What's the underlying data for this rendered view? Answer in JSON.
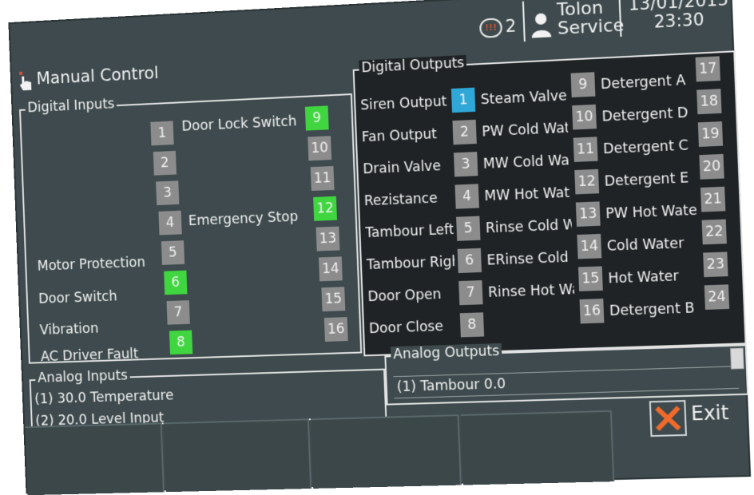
{
  "header": {
    "title": "Manual Control",
    "notification_count": "2",
    "notification_icon_text": "!!!",
    "user": {
      "line1": "Tolon",
      "line2": "Service"
    },
    "date": "13/01/2015",
    "time": "23:30"
  },
  "digital_inputs": {
    "title": "Digital Inputs",
    "labels": {
      "door_lock_switch": "Door Lock Switch",
      "emergency_stop": "Emergency Stop",
      "motor_protection": "Motor Protection",
      "door_switch": "Door Switch",
      "vibration": "Vibration",
      "ac_driver_fault": "AC Driver Fault"
    },
    "left_numbers": [
      "1",
      "2",
      "3",
      "4",
      "5",
      "6",
      "7",
      "8"
    ],
    "right_numbers": [
      "9",
      "10",
      "11",
      "12",
      "13",
      "14",
      "15",
      "16"
    ],
    "active": [
      "6",
      "8",
      "9",
      "12"
    ]
  },
  "digital_outputs": {
    "title": "Digital Outputs",
    "col1": [
      {
        "label": "Siren Output",
        "num": "1"
      },
      {
        "label": "Fan Output",
        "num": "2"
      },
      {
        "label": "Drain Valve",
        "num": "3"
      },
      {
        "label": "Rezistance",
        "num": "4"
      },
      {
        "label": "Tambour Left",
        "num": "5"
      },
      {
        "label": "Tambour Right",
        "num": "6"
      },
      {
        "label": "Door Open",
        "num": "7"
      },
      {
        "label": "Door Close",
        "num": "8"
      }
    ],
    "col2": [
      {
        "label": "Steam Valve",
        "num": "9"
      },
      {
        "label": "PW Cold Water",
        "num": "10"
      },
      {
        "label": "MW Cold Water",
        "num": "11"
      },
      {
        "label": "MW Hot Water",
        "num": "12"
      },
      {
        "label": "Rinse Cold Water",
        "num": "13"
      },
      {
        "label": "ERinse Cold",
        "num": "14"
      },
      {
        "label": "Rinse Hot Water",
        "num": "15"
      },
      {
        "label": "",
        "num": "16"
      }
    ],
    "col3": [
      {
        "label": "Detergent A",
        "num": "17"
      },
      {
        "label": "Detergent D",
        "num": "18"
      },
      {
        "label": "Detergent C",
        "num": "19"
      },
      {
        "label": "Detergent E",
        "num": "20"
      },
      {
        "label": "PW Hot Water",
        "num": "21"
      },
      {
        "label": "Cold Water",
        "num": "22"
      },
      {
        "label": "Hot Water",
        "num": "23"
      },
      {
        "label": "Detergent B",
        "num": "24"
      }
    ],
    "selected": "1"
  },
  "analog_inputs": {
    "title": "Analog Inputs",
    "lines": [
      "(1) 30.0 Temperature",
      "(2) 20.0 Level Input"
    ]
  },
  "analog_outputs": {
    "title": "Analog Outputs",
    "lines": [
      "(1) Tambour 0.0"
    ]
  },
  "footer": {
    "exit_label": "Exit"
  },
  "colors": {
    "background": "#3e4a4d",
    "active": "#3fd63f",
    "selected": "#2fa8d8",
    "inactive": "#8c8c8c",
    "outputs_panel": "#1f2325",
    "exit_x": "#f26a2a"
  }
}
